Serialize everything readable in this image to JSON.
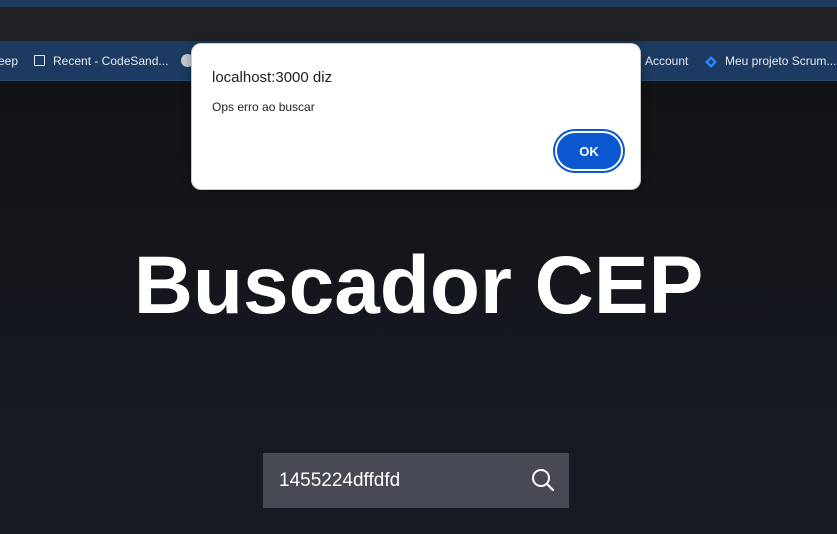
{
  "bookmarks": [
    {
      "label": "eep",
      "icon": "none"
    },
    {
      "label": "Recent - CodeSand...",
      "icon": "codesandbox-square-icon"
    },
    {
      "label": "Account",
      "icon": "none"
    },
    {
      "label": "Meu projeto Scrum...",
      "icon": "jira-diamond-icon"
    }
  ],
  "main": {
    "title": "Buscador CEP",
    "search_value": "1455224dffdfd"
  },
  "dialog": {
    "title": "localhost:3000 diz",
    "message": "Ops erro ao buscar",
    "ok_label": "OK"
  },
  "colors": {
    "bookmarks_bar": "#1d3b62",
    "page_background": "#14161b",
    "search_box": "#474a55",
    "ok_button": "#0b57d0",
    "jira_icon": "#2684ff"
  }
}
